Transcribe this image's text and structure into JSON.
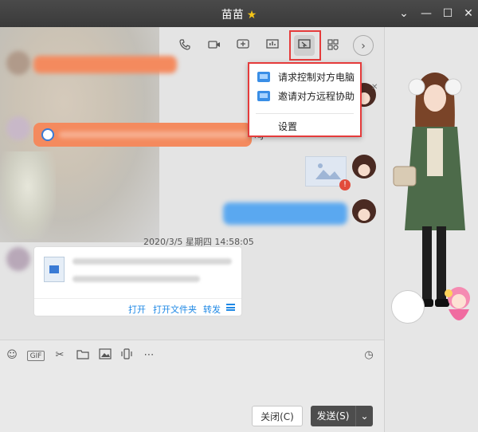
{
  "window": {
    "title": "苗苗",
    "star_icon": "star-icon",
    "controls": [
      "chevron-down-icon",
      "minimize-icon",
      "maximize-icon",
      "close-icon"
    ]
  },
  "toolbar": {
    "icons": [
      "phone-icon",
      "video-icon",
      "add-message-icon",
      "presentation-icon",
      "remote-desktop-icon",
      "apps-icon",
      "chevron-right-icon"
    ]
  },
  "remote_menu": {
    "items": [
      {
        "label": "请求控制对方电脑",
        "icon": "remote-request-icon"
      },
      {
        "label": "邀请对方远程协助",
        "icon": "remote-invite-icon"
      },
      {
        "label": "设置",
        "icon": ""
      }
    ]
  },
  "chat": {
    "bubble2_visible_text": "吗",
    "timestamp": "2020/3/5 星期四 14:58:05",
    "file_card": {
      "actions": [
        "打开",
        "打开文件夹",
        "转发"
      ]
    }
  },
  "input": {
    "tools": [
      "emoji-icon",
      "gif-icon",
      "scissors-icon",
      "folder-icon",
      "image-icon",
      "shake-icon",
      "more-icon"
    ],
    "history_icon": "clock-icon",
    "close_label": "关闭(C)",
    "send_label": "发送(S)"
  },
  "colors": {
    "accent_red": "#e53b3b",
    "link_blue": "#1e88e5",
    "orange_bubble": "#f48a5e",
    "blue_bubble": "#5aa8f0"
  }
}
